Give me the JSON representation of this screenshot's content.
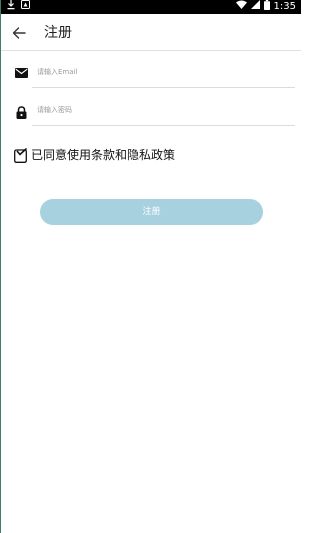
{
  "status_bar": {
    "time": "1:35",
    "left_icons": [
      "download-icon",
      "app-notification-icon"
    ],
    "right_icons": [
      "wifi-icon",
      "signal-icon",
      "battery-icon"
    ]
  },
  "header": {
    "back_icon": "arrow-left-icon",
    "title": "注册"
  },
  "form": {
    "email": {
      "icon": "mail-icon",
      "placeholder": "请输入Email",
      "value": ""
    },
    "password": {
      "icon": "lock-icon",
      "placeholder": "请输入密码",
      "value": ""
    },
    "agreement": {
      "checked": false,
      "label": "已同意使用条款和隐私政策"
    },
    "submit_label": "注册"
  },
  "colors": {
    "status_bar": "#000000",
    "submit_button": "#a8d1e0",
    "text": "#111111",
    "placeholder": "#9a9a9a"
  }
}
